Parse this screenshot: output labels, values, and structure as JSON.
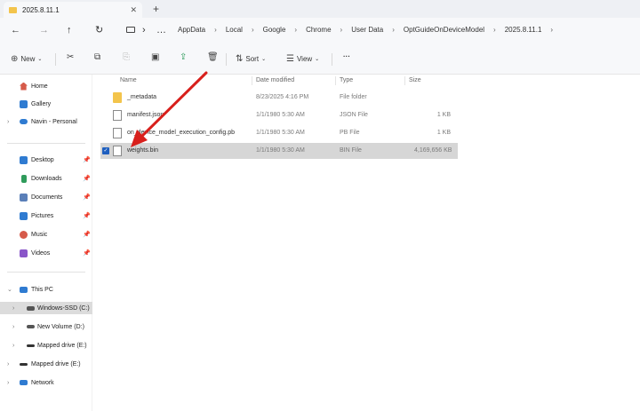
{
  "tab": {
    "title": "2025.8.11.1",
    "close": "✕",
    "new": "+"
  },
  "nav": {
    "back": "←",
    "forward": "→",
    "up": "↑",
    "refresh": "↻",
    "more": "…",
    "breadcrumb": [
      "AppData",
      "Local",
      "Google",
      "Chrome",
      "User Data",
      "OptGuideOnDeviceModel",
      "2025.8.11.1"
    ],
    "separator": "›"
  },
  "commands": {
    "new": "New",
    "sort": "Sort",
    "view": "View",
    "more": "···"
  },
  "sidebar": {
    "top": [
      {
        "label": "Home",
        "icon": "home-icon",
        "color": "#d65a4a"
      },
      {
        "label": "Gallery",
        "icon": "gallery-icon",
        "color": "#2f7bd1"
      },
      {
        "label": "Navin - Personal",
        "icon": "cloud-icon",
        "color": "#2f7bd1"
      }
    ],
    "quick": [
      {
        "label": "Desktop",
        "icon": "desktop-icon",
        "color": "#2f7bd1"
      },
      {
        "label": "Downloads",
        "icon": "downloads-icon",
        "color": "#2f9b5b"
      },
      {
        "label": "Documents",
        "icon": "documents-icon",
        "color": "#5a7fb8"
      },
      {
        "label": "Pictures",
        "icon": "pictures-icon",
        "color": "#2f7bd1"
      },
      {
        "label": "Music",
        "icon": "music-icon",
        "color": "#d65a4a"
      },
      {
        "label": "Videos",
        "icon": "videos-icon",
        "color": "#8a56c9"
      }
    ],
    "drives": [
      {
        "label": "This PC",
        "icon": "pc-icon",
        "color": "#2f7bd1",
        "expanded": true
      },
      {
        "label": "Windows-SSD (C:)",
        "icon": "drive-icon",
        "color": "#555555",
        "selected": true
      },
      {
        "label": "New Volume (D:)",
        "icon": "drive-icon",
        "color": "#555555"
      },
      {
        "label": "Mapped drive (E:)",
        "icon": "drive-icon",
        "color": "#333333"
      },
      {
        "label": "Mapped drive (E:)",
        "icon": "drive-icon",
        "color": "#333333"
      },
      {
        "label": "Network",
        "icon": "network-icon",
        "color": "#2f7bd1"
      }
    ]
  },
  "columns": {
    "name": "Name",
    "date": "Date modified",
    "type": "Type",
    "size": "Size"
  },
  "files": [
    {
      "name": "_metadata",
      "date": "8/23/2025 4:16 PM",
      "type": "File folder",
      "size": "",
      "kind": "folder"
    },
    {
      "name": "manifest.json",
      "date": "1/1/1980 5:30 AM",
      "type": "JSON File",
      "size": "1 KB",
      "kind": "file"
    },
    {
      "name": "on_device_model_execution_config.pb",
      "date": "1/1/1980 5:30 AM",
      "type": "PB File",
      "size": "1 KB",
      "kind": "file"
    },
    {
      "name": "weights.bin",
      "date": "1/1/1980 5:30 AM",
      "type": "BIN File",
      "size": "4,169,656 KB",
      "kind": "file",
      "selected": true
    }
  ],
  "annotation_color": "#d8201c"
}
